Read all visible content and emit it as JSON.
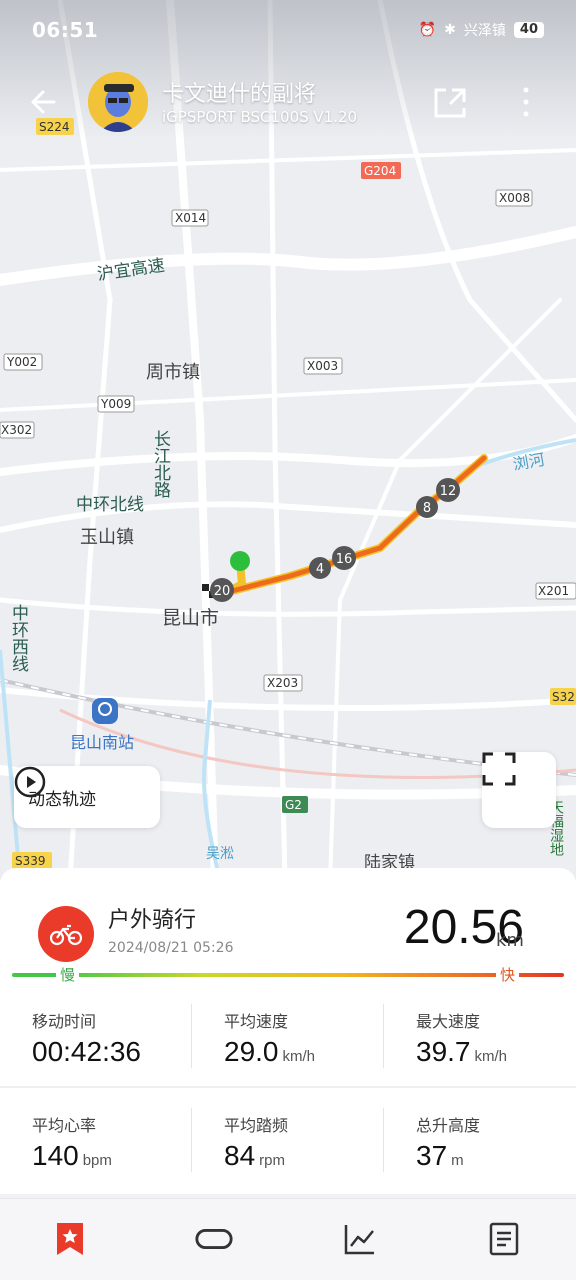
{
  "status": {
    "time": "06:51",
    "network": "兴泽镇",
    "battery": "40"
  },
  "header": {
    "user_name": "卡文迪什的副将",
    "device": "iGPSPORT BSC100S  V1.20"
  },
  "map": {
    "road_labels": [
      "S224",
      "G204",
      "X014",
      "X008",
      "沪宜高速",
      "Y002",
      "周市镇",
      "X003",
      "Y009",
      "X302",
      "长江北路",
      "浏河",
      "中环北线",
      "玉山镇",
      "X201",
      "昆山市",
      "中环西线",
      "X203",
      "S32",
      "昆山南站",
      "G2",
      "S339",
      "陆家镇",
      "天福湿地",
      "吴淞"
    ],
    "km_markers": [
      "20",
      "4",
      "16",
      "8",
      "12"
    ]
  },
  "controls": {
    "replay_label": "动态轨迹"
  },
  "summary": {
    "sport": "户外骑行",
    "date": "2024/08/21 05:26",
    "distance": "20.56",
    "distance_unit": "km",
    "slow_label": "慢",
    "fast_label": "快"
  },
  "stats": [
    {
      "label": "移动时间",
      "value": "00:42:36",
      "unit": ""
    },
    {
      "label": "平均速度",
      "value": "29.0",
      "unit": "km/h"
    },
    {
      "label": "最大速度",
      "value": "39.7",
      "unit": "km/h"
    },
    {
      "label": "平均心率",
      "value": "140",
      "unit": "bpm"
    },
    {
      "label": "平均踏频",
      "value": "84",
      "unit": "rpm"
    },
    {
      "label": "总升高度",
      "value": "37",
      "unit": "m"
    }
  ],
  "colors": {
    "accent_red": "#ea3a2a",
    "route_orange": "#f08a1c",
    "start_green": "#2dbf3c"
  }
}
